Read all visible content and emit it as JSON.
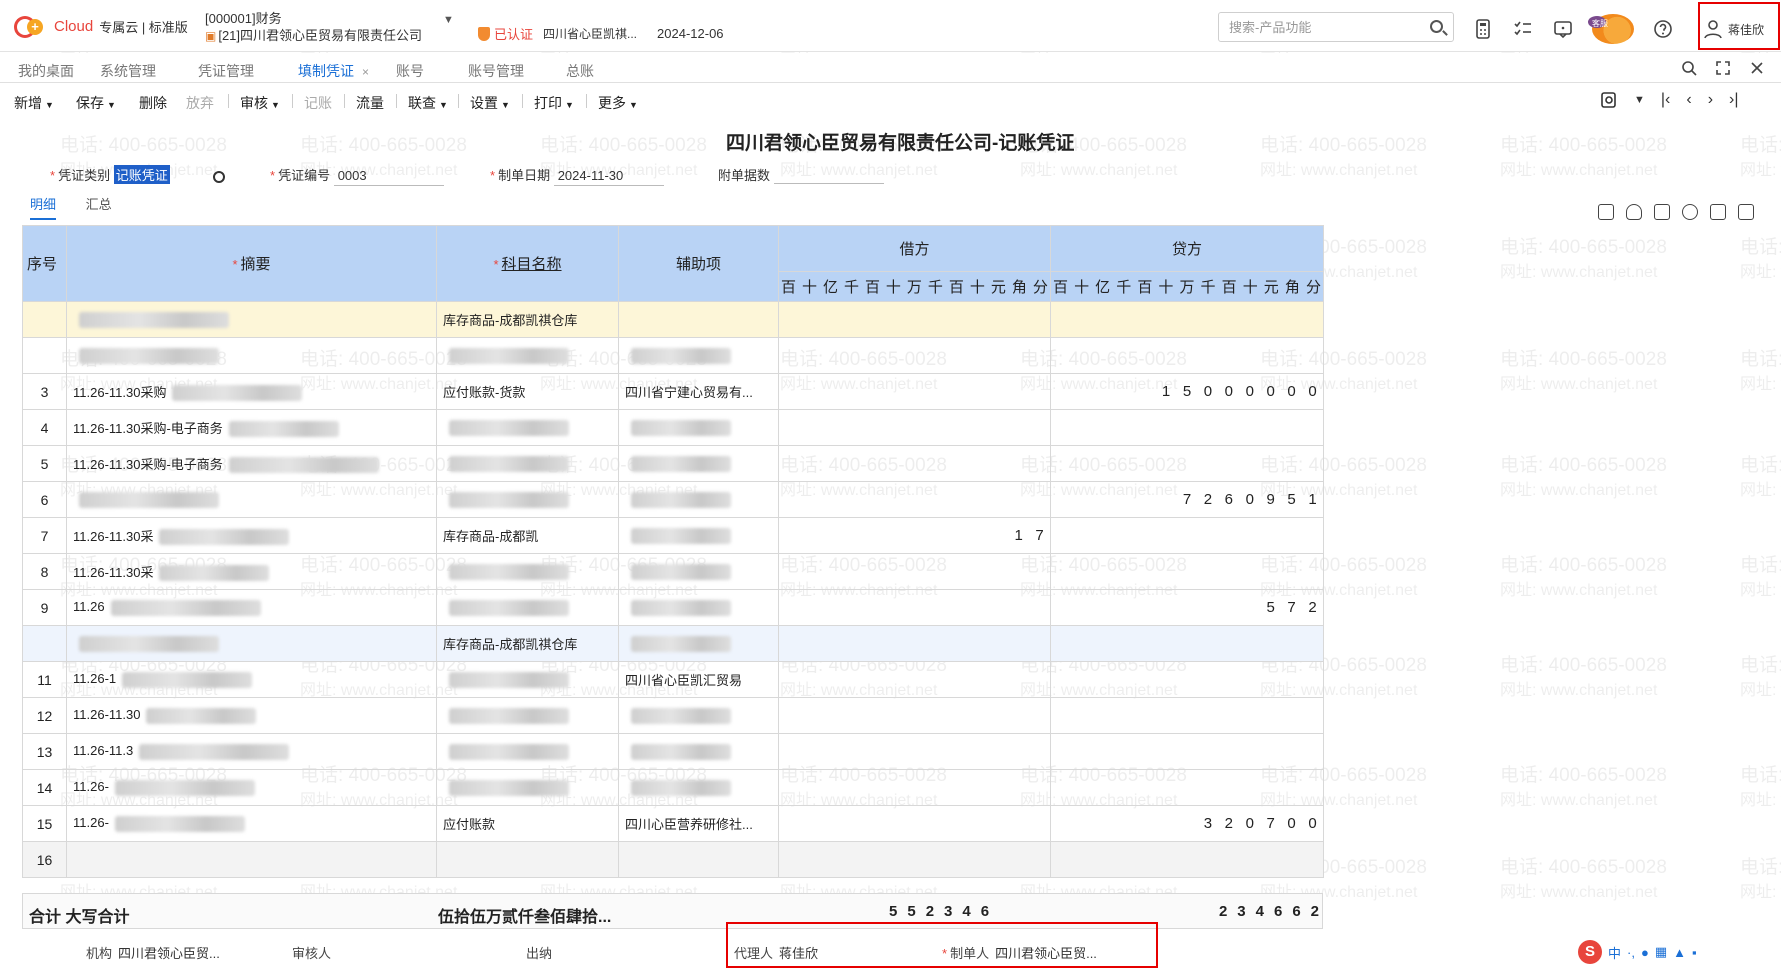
{
  "header": {
    "logo_text": "Cloud",
    "logo_sub": "专属云 | 标准版",
    "account_code": "[000001]财务",
    "company": "[21]四川君领心臣贸易有限责任公司",
    "certified": "已认证",
    "certified_company": "四川省心臣凯祺...",
    "date": "2024-12-06",
    "search_placeholder": "搜索-产品功能",
    "mascot_label": "客服",
    "user_name": "蒋佳欣"
  },
  "module_tabs": [
    {
      "label": "我的桌面"
    },
    {
      "label": "系统管理"
    },
    {
      "label": "凭证管理"
    },
    {
      "label": "填制凭证",
      "active": true,
      "close": "×"
    },
    {
      "label": "账号"
    },
    {
      "label": "账号管理"
    },
    {
      "label": "总账"
    }
  ],
  "actions": [
    {
      "label": "新增",
      "dropdown": true
    },
    {
      "label": "保存",
      "dropdown": true
    },
    {
      "label": "删除"
    },
    {
      "label": "放弃",
      "disabled": true
    },
    {
      "label": "审核",
      "dropdown": true
    },
    {
      "label": "记账",
      "disabled": true
    },
    {
      "label": "流量"
    },
    {
      "label": "联查",
      "dropdown": true
    },
    {
      "label": "设置",
      "dropdown": true
    },
    {
      "label": "打印",
      "dropdown": true
    },
    {
      "label": "更多",
      "dropdown": true
    }
  ],
  "voucher": {
    "title": "四川君领心臣贸易有限责任公司-记账凭证",
    "type_label": "凭证类别",
    "type_value": "记账凭证",
    "number_label": "凭证编号",
    "number_value": "0003",
    "date_label": "制单日期",
    "date_value": "2024-11-30",
    "attach_label": "附单据数",
    "subtabs": [
      "明细",
      "汇总"
    ]
  },
  "table": {
    "col_seq": "序号",
    "col_summary": "摘要",
    "col_account": "科目名称",
    "col_aux": "辅助项",
    "col_debit": "借方",
    "col_credit": "贷方",
    "digit_units": [
      "百",
      "十",
      "亿",
      "千",
      "百",
      "十",
      "万",
      "千",
      "百",
      "十",
      "元",
      "角",
      "分"
    ],
    "rows": [
      {
        "seq": "",
        "summary": "",
        "account": "库存商品-成都凯祺仓库",
        "aux": "",
        "debit": "",
        "credit": ""
      },
      {
        "seq": "",
        "summary": "",
        "account": "",
        "aux": "",
        "debit": "",
        "credit": ""
      },
      {
        "seq": "3",
        "summary": "11.26-11.30采购",
        "account": "应付账款-货款",
        "aux": "四川省宁建心贸易有...",
        "debit": "",
        "credit": "15000000"
      },
      {
        "seq": "4",
        "summary": "11.26-11.30采购-电子商务",
        "account": "",
        "aux": "",
        "debit": "",
        "credit": ""
      },
      {
        "seq": "5",
        "summary": "11.26-11.30采购-电子商务",
        "account": "",
        "aux": "",
        "debit": "",
        "credit": ""
      },
      {
        "seq": "6",
        "summary": "",
        "account": "",
        "aux": "",
        "debit": "",
        "credit": "7260951"
      },
      {
        "seq": "7",
        "summary": "11.26-11.30采",
        "account": "库存商品-成都凯",
        "aux": "",
        "debit": "17",
        "credit": ""
      },
      {
        "seq": "8",
        "summary": "11.26-11.30采",
        "account": "",
        "aux": "",
        "debit": "",
        "credit": ""
      },
      {
        "seq": "9",
        "summary": "11.26",
        "account": "",
        "aux": "",
        "debit": "",
        "credit": "572"
      },
      {
        "seq": "",
        "summary": "",
        "account": "库存商品-成都凯祺仓库",
        "aux": "",
        "debit": "",
        "credit": ""
      },
      {
        "seq": "11",
        "summary": "11.26-1",
        "account": "",
        "aux": "四川省心臣凯汇贸易",
        "debit": "",
        "credit": ""
      },
      {
        "seq": "12",
        "summary": "11.26-11.30",
        "account": "",
        "aux": "",
        "debit": "",
        "credit": ""
      },
      {
        "seq": "13",
        "summary": "11.26-11.3",
        "account": "",
        "aux": "",
        "debit": "",
        "credit": ""
      },
      {
        "seq": "14",
        "summary": "11.26-",
        "account": "",
        "aux": "",
        "debit": "",
        "credit": ""
      },
      {
        "seq": "15",
        "summary": "11.26-",
        "account": "应付账款",
        "aux": "四川心臣营养研修社...",
        "debit": "",
        "credit": "320700"
      },
      {
        "seq": "16",
        "summary": "",
        "account": "",
        "aux": "",
        "debit": "",
        "credit": ""
      }
    ]
  },
  "totals": {
    "label": "合计 大写合计",
    "words": "伍拾伍万贰仟叁佰肆拾...",
    "debit_digits": [
      "5",
      "5",
      "2",
      "3",
      "4",
      "6"
    ],
    "credit_digits": [
      "2",
      "3",
      "4",
      "6",
      "6",
      "2"
    ]
  },
  "footer": {
    "org_label": "机构",
    "org_value": "四川君领心臣贸...",
    "auditor_label": "审核人",
    "cashier_label": "出纳",
    "agent_label": "代理人",
    "agent_value": "蒋佳欣",
    "maker_label": "制单人",
    "maker_value": "四川君领心臣贸..."
  },
  "watermark": {
    "phone": "电话: 400-665-0028",
    "site": "网址: www.chanjet.net"
  },
  "ime": {
    "lang": "中",
    "extra": "·,"
  },
  "colors": {
    "accent": "#1a6fd6",
    "header_blue": "#b9d3f5",
    "highlight_red": "#e60000"
  }
}
